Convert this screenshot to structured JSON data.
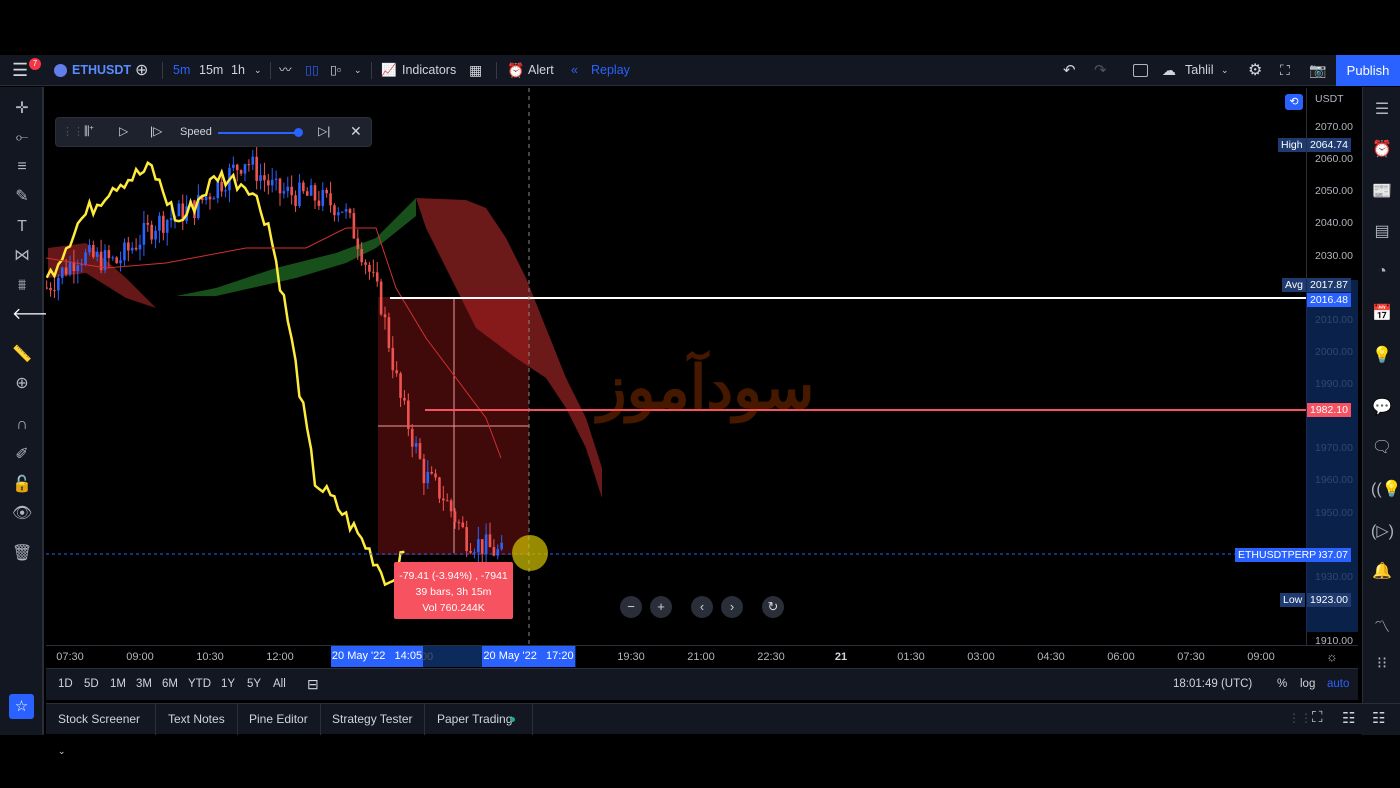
{
  "toolbar": {
    "notifications": "7",
    "symbol": "ETHUSDT",
    "intervals": [
      "5m",
      "15m",
      "1h"
    ],
    "indicators": "Indicators",
    "alert": "Alert",
    "replay": "Replay",
    "layout_name": "Tahlil",
    "publish": "Publish"
  },
  "replay_bar": {
    "speed_label": "Speed",
    "speed_level": 1.0
  },
  "price_axis": {
    "currency": "USDT",
    "ticks": [
      "2070.00",
      "2060.00",
      "2050.00",
      "2040.00",
      "2030.00",
      "2010.00",
      "2000.00",
      "1990.00",
      "1970.00",
      "1960.00",
      "1950.00",
      "1930.00",
      "1910.00"
    ],
    "high_label": "High",
    "high": "2064.74",
    "avg_label": "Avg",
    "avg": "2017.87",
    "entry": "2016.48",
    "target": "1982.10",
    "symbol_label": "ETHUSDTPERP",
    "last": "1937.07",
    "low_label": "Low",
    "low": "1923.00"
  },
  "measure": {
    "line1": "-79.41 (-3.94%) , -7941",
    "line2": "39 bars, 3h 15m",
    "line3": "Vol 760.244K"
  },
  "time_axis": {
    "labels": [
      "07:30",
      "09:00",
      "10:30",
      "12:00",
      "19:30",
      "21:00",
      "22:30",
      "21",
      "01:30",
      "03:00",
      "04:30",
      "06:00",
      "07:30",
      "09:00"
    ],
    "start_tag": "20 May '22   14:05",
    "end_tag": "20 May '22   17:20",
    "hidden_fragment": "00"
  },
  "range_bar": {
    "ranges": [
      "1D",
      "5D",
      "1M",
      "3M",
      "6M",
      "YTD",
      "1Y",
      "5Y",
      "All"
    ],
    "clock": "18:01:49 (UTC)",
    "percent": "%",
    "log": "log",
    "auto": "auto"
  },
  "bottom_panel": {
    "tabs": [
      "Stock Screener",
      "Text Notes",
      "Pine Editor",
      "Strategy Tester",
      "Paper Trading"
    ]
  },
  "watermark": "سودآموز",
  "colors": {
    "accent": "#2962ff",
    "up": "#2962ff",
    "down": "#ef5350",
    "line": "#ffeb3b",
    "target": "#f7525f",
    "cloud_green": "#1b5e20",
    "cloud_red": "#7f1d1d"
  },
  "chart_data": {
    "type": "candlestick",
    "symbol": "ETHUSDT",
    "interval": "5m",
    "ylim": [
      1910,
      2070
    ],
    "price_keypoints": [
      [
        "07:00",
        2020
      ],
      [
        "07:40",
        2030
      ],
      [
        "08:30",
        2028
      ],
      [
        "09:20",
        2040
      ],
      [
        "10:10",
        2045
      ],
      [
        "11:15",
        2060
      ],
      [
        "11:55",
        2050
      ],
      [
        "12:45",
        2048
      ],
      [
        "13:20",
        2045
      ],
      [
        "13:40",
        2035
      ],
      [
        "14:10",
        2015
      ],
      [
        "14:35",
        1985
      ],
      [
        "15:05",
        1962
      ],
      [
        "15:30",
        1955
      ],
      [
        "16:00",
        1942
      ],
      [
        "16:45",
        1937
      ]
    ],
    "line_keypoints": [
      [
        "07:00",
        2022
      ],
      [
        "07:40",
        2040
      ],
      [
        "08:25",
        2052
      ],
      [
        "09:15",
        2057
      ],
      [
        "09:50",
        2040
      ],
      [
        "10:40",
        2055
      ],
      [
        "11:20",
        2052
      ],
      [
        "11:45",
        2040
      ],
      [
        "12:10",
        2010
      ],
      [
        "12:45",
        1960
      ],
      [
        "13:20",
        1950
      ],
      [
        "13:55",
        1938
      ],
      [
        "14:20",
        1928
      ],
      [
        "14:40",
        1937
      ]
    ]
  }
}
